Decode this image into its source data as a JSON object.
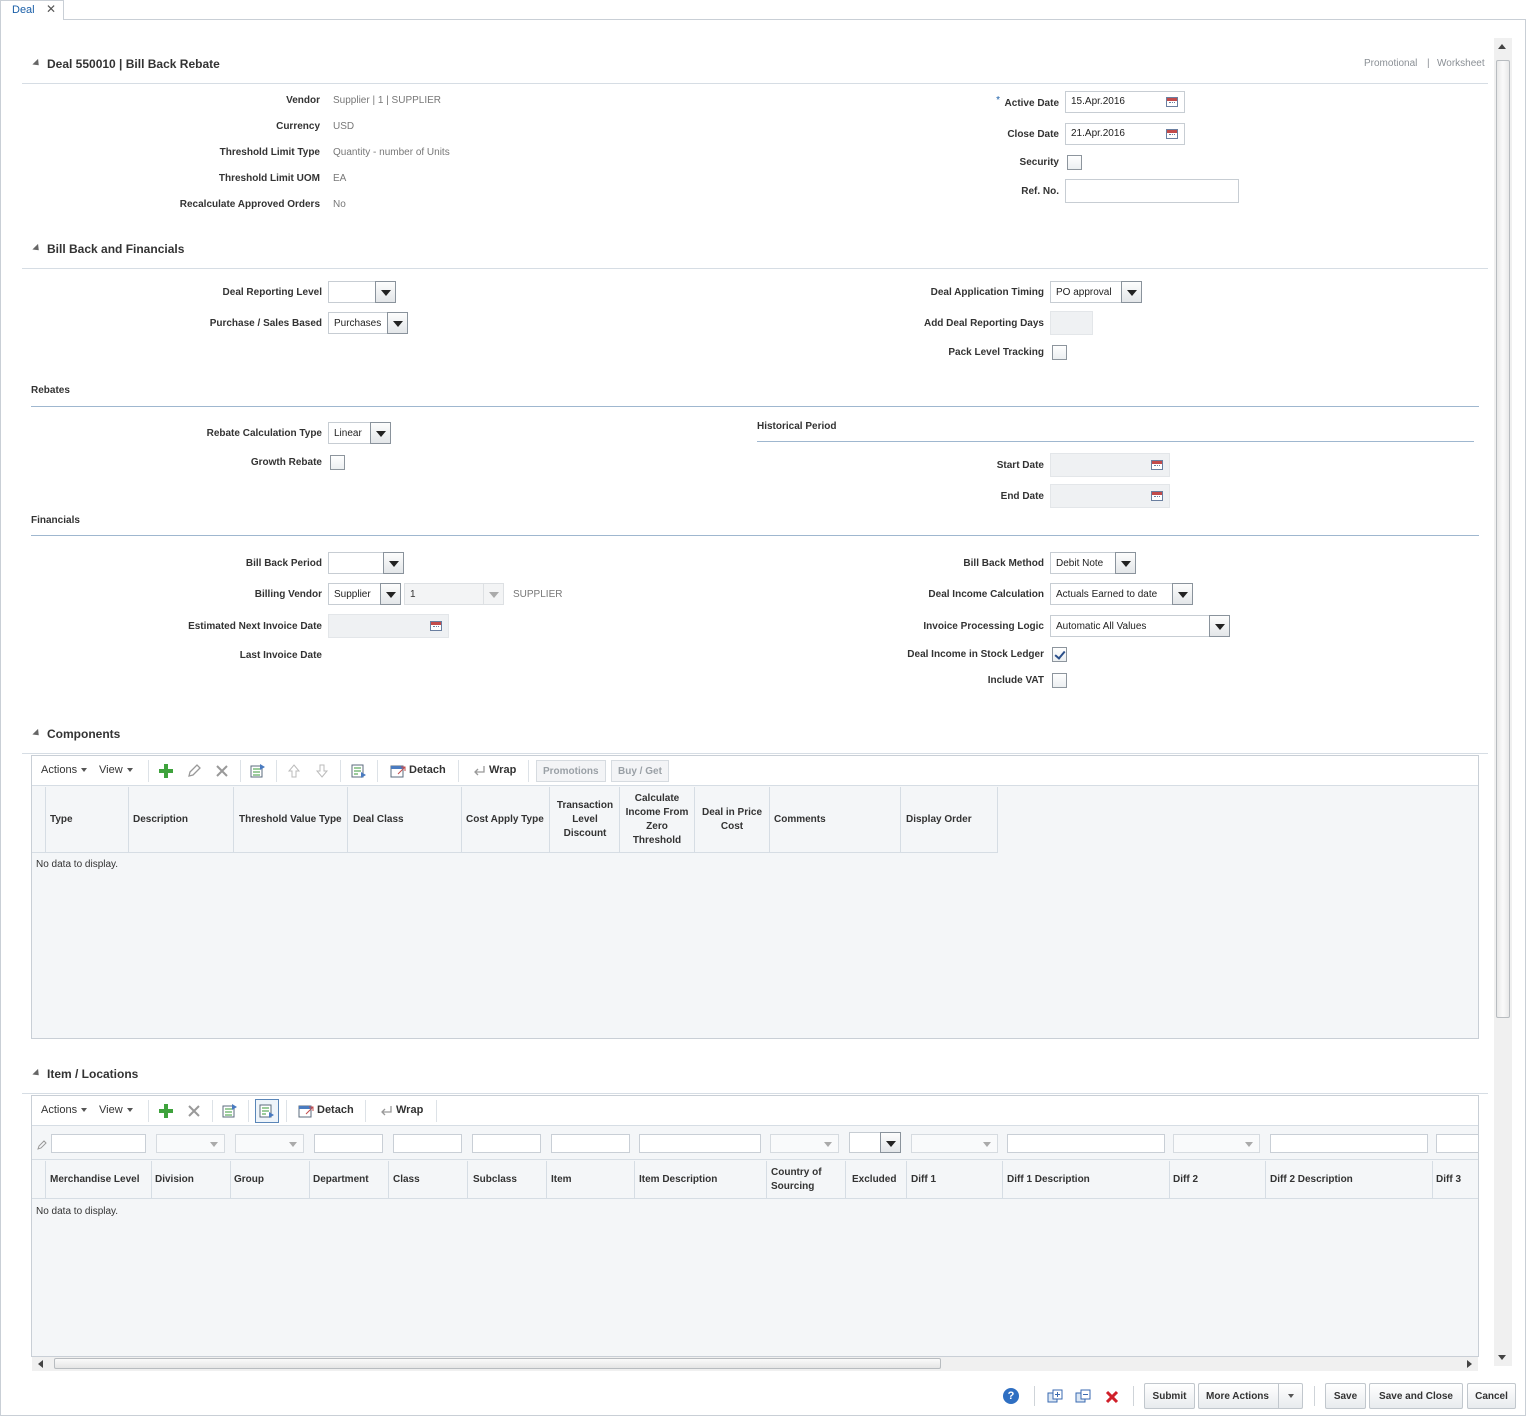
{
  "tab": {
    "label": "Deal",
    "close": "✕"
  },
  "header": {
    "title": "Deal 550010  |  Bill Back Rebate",
    "links": [
      "Promotional",
      "Worksheet"
    ],
    "link_sep": "|"
  },
  "deal_info": {
    "left": [
      {
        "label": "Vendor",
        "value": "Supplier  |  1  |  SUPPLIER"
      },
      {
        "label": "Currency",
        "value": "USD"
      },
      {
        "label": "Threshold Limit Type",
        "value": "Quantity - number of Units"
      },
      {
        "label": "Threshold Limit UOM",
        "value": "EA"
      },
      {
        "label": "Recalculate Approved Orders",
        "value": "No"
      }
    ],
    "active_date": {
      "label": "Active Date",
      "value": "15.Apr.2016",
      "required": "*"
    },
    "close_date": {
      "label": "Close Date",
      "value": "21.Apr.2016"
    },
    "security": {
      "label": "Security",
      "checked": false
    },
    "ref_no": {
      "label": "Ref. No.",
      "value": ""
    }
  },
  "billback": {
    "title": "Bill Back and Financials",
    "deal_reporting_level": {
      "label": "Deal Reporting Level",
      "value": ""
    },
    "purchase_sales_based": {
      "label": "Purchase / Sales Based",
      "value": "Purchases"
    },
    "deal_application_timing": {
      "label": "Deal Application Timing",
      "value": "PO approval"
    },
    "add_deal_reporting_days": {
      "label": "Add Deal Reporting Days",
      "value": ""
    },
    "pack_level_tracking": {
      "label": "Pack Level Tracking",
      "checked": false
    }
  },
  "rebates": {
    "title": "Rebates",
    "rebate_calculation_type": {
      "label": "Rebate Calculation Type",
      "value": "Linear"
    },
    "growth_rebate": {
      "label": "Growth Rebate",
      "checked": false
    },
    "historical_period": {
      "title": "Historical Period",
      "start_label": "Start Date",
      "end_label": "End Date"
    }
  },
  "financials": {
    "title": "Financials",
    "bill_back_period": {
      "label": "Bill Back Period",
      "value": ""
    },
    "billing_vendor": {
      "label": "Billing Vendor",
      "type": "Supplier",
      "id": "1",
      "name": "SUPPLIER"
    },
    "estimated_next_invoice_date": {
      "label": "Estimated Next Invoice Date"
    },
    "last_invoice_date": {
      "label": "Last Invoice Date",
      "value": ""
    },
    "bill_back_method": {
      "label": "Bill Back Method",
      "value": "Debit Note"
    },
    "deal_income_calculation": {
      "label": "Deal Income Calculation",
      "value": "Actuals Earned to date"
    },
    "invoice_processing_logic": {
      "label": "Invoice Processing Logic",
      "value": "Automatic All Values"
    },
    "deal_income_in_stock_ledger": {
      "label": "Deal Income in Stock Ledger",
      "checked": true
    },
    "include_vat": {
      "label": "Include VAT",
      "checked": false
    }
  },
  "components": {
    "title": "Components",
    "toolbar": {
      "actions": "Actions",
      "view": "View",
      "detach": "Detach",
      "wrap": "Wrap",
      "promotions": "Promotions",
      "buy_get": "Buy / Get"
    },
    "columns": [
      "Type",
      "Description",
      "Threshold Value Type",
      "Deal Class",
      "Cost Apply Type",
      "Transaction Level Discount",
      "Calculate Income From Zero Threshold",
      "Deal in Price Cost",
      "Comments",
      "Display Order"
    ],
    "empty": "No data to display."
  },
  "item_locations": {
    "title": "Item / Locations",
    "toolbar": {
      "actions": "Actions",
      "view": "View",
      "detach": "Detach",
      "wrap": "Wrap"
    },
    "columns": [
      "Merchandise Level",
      "Division",
      "Group",
      "Department",
      "Class",
      "Subclass",
      "Item",
      "Item Description",
      "Country of Sourcing",
      "Excluded",
      "Diff 1",
      "Diff 1 Description",
      "Diff 2",
      "Diff 2 Description",
      "Diff 3"
    ],
    "empty": "No data to display."
  },
  "footer": {
    "submit": "Submit",
    "more_actions": "More Actions",
    "save": "Save",
    "save_and_close": "Save and Close",
    "cancel": "Cancel"
  }
}
